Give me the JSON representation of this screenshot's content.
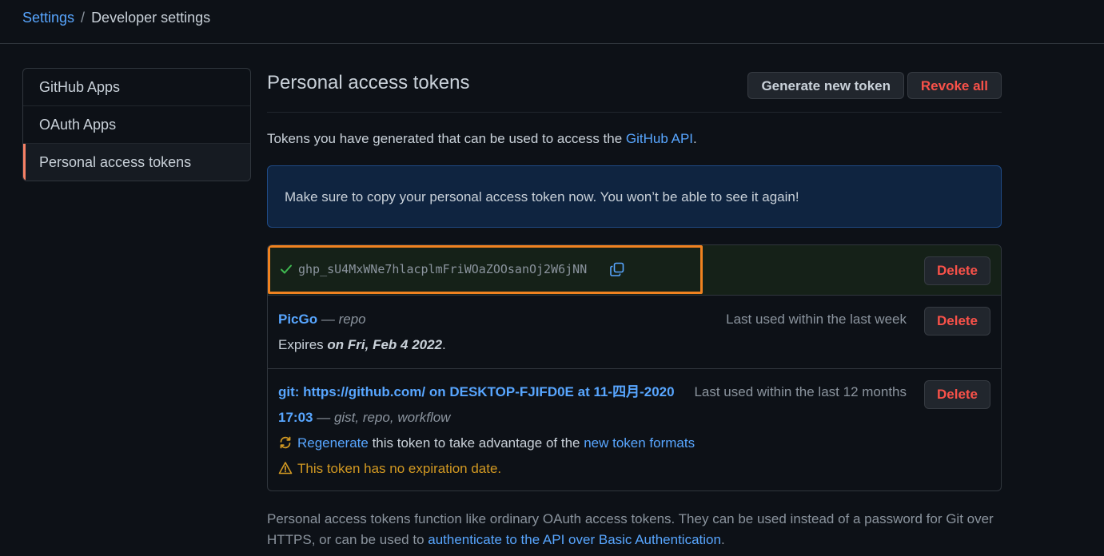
{
  "breadcrumb": {
    "parent": "Settings",
    "separator": "/",
    "current": "Developer settings"
  },
  "sidebar": {
    "items": [
      {
        "label": "GitHub Apps"
      },
      {
        "label": "OAuth Apps"
      },
      {
        "label": "Personal access tokens",
        "selected": true
      }
    ]
  },
  "main": {
    "title": "Personal access tokens",
    "generate_label": "Generate new token",
    "revoke_label": "Revoke all",
    "intro_prefix": "Tokens you have generated that can be used to access the ",
    "intro_link": "GitHub API",
    "intro_suffix": ".",
    "flash": "Make sure to copy your personal access token now. You won’t be able to see it again!"
  },
  "tokens": {
    "new_token": {
      "value": "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",
      "delete_label": "Delete"
    },
    "picgo": {
      "name": "PicGo",
      "dash": "—",
      "scopes": "repo",
      "last_used": "Last used within the last week",
      "expires_prefix": "Expires ",
      "expires_date": "on Fri, Feb 4 2022",
      "expires_suffix": ".",
      "delete_label": "Delete"
    },
    "git": {
      "name_line1": "git: https://github.com/ on DESKTOP-FJIFD0E at 11-四月-2020",
      "name_line2": "17:03",
      "dash": "—",
      "scopes": "gist, repo, workflow",
      "last_used": "Last used within the last 12 months",
      "regenerate_link": "Regenerate",
      "regenerate_middle": " this token to take advantage of the ",
      "formats_link": "new token formats",
      "warning": "This token has no expiration date.",
      "delete_label": "Delete"
    }
  },
  "footer": {
    "text": "Personal access tokens function like ordinary OAuth access tokens. They can be used instead of a password for Git over HTTPS, or can be used to ",
    "link": "authenticate to the API over Basic Authentication",
    "suffix": "."
  },
  "colors": {
    "link": "#58a6ff",
    "danger": "#f85149",
    "success": "#3fb950",
    "warning": "#d29922",
    "highlight": "#f08220"
  },
  "icons": [
    "check-icon",
    "copy-icon",
    "sync-icon",
    "alert-icon"
  ]
}
